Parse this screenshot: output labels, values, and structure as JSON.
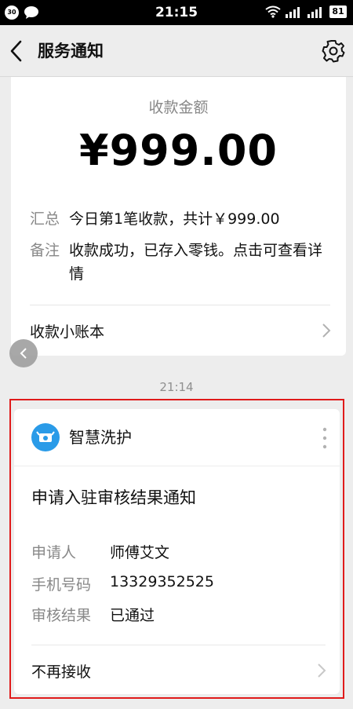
{
  "status_bar": {
    "notification_count": "30",
    "time": "21:15",
    "battery": "81"
  },
  "navbar": {
    "title": "服务通知"
  },
  "payment_card": {
    "label": "收款金额",
    "amount": "¥999.00",
    "summary_key": "汇总",
    "summary_value": "今日第1笔收款，共计￥999.00",
    "note_key": "备注",
    "note_value": "收款成功，已存入零钱。点击可查看详情",
    "link_label": "收款小账本"
  },
  "timestamp": "21:14",
  "review_card": {
    "app_name": "智慧洗护",
    "title": "申请入驻审核结果通知",
    "rows": [
      {
        "key": "申请人",
        "value": "师傅艾文"
      },
      {
        "key": "手机号码",
        "value": "13329352525"
      },
      {
        "key": "审核结果",
        "value": "已通过"
      }
    ],
    "footer_label": "不再接收"
  },
  "colors": {
    "background": "#ededed",
    "card": "#ffffff",
    "highlight_border": "#e01b1b",
    "logo": "#2a9be8"
  }
}
